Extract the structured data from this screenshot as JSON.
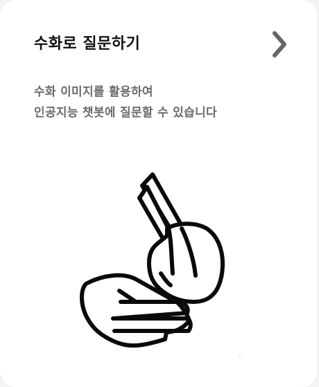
{
  "card": {
    "title": "수화로 질문하기",
    "description_line1": "수화 이미지를 활용하여",
    "description_line2": "인공지능 챗봇에 질문할 수 있습니다",
    "chevron_icon": "chevron-right-icon",
    "illustration_icon": "sign-language-hands-icon"
  }
}
